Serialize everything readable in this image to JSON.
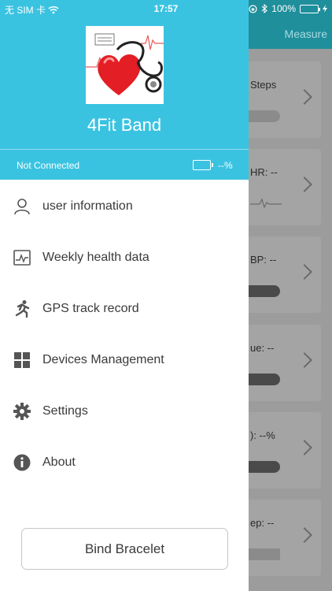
{
  "status_bar": {
    "carrier": "无 SIM 卡",
    "time": "17:57",
    "battery_percent": "100%"
  },
  "background_screen": {
    "header_action": "Measure",
    "cards": [
      {
        "label": "Steps"
      },
      {
        "label": "HR: --"
      },
      {
        "label": "BP: --"
      },
      {
        "label": "ue: --"
      },
      {
        "label": "): --%"
      },
      {
        "label": "ep: --"
      }
    ]
  },
  "drawer": {
    "app_name": "4Fit Band",
    "connection_status": "Not Connected",
    "device_battery": "--%",
    "menu": [
      {
        "label": "user information",
        "icon": "user-icon"
      },
      {
        "label": "Weekly health data",
        "icon": "health-chart-icon"
      },
      {
        "label": "GPS track record",
        "icon": "running-icon"
      },
      {
        "label": "Devices Management",
        "icon": "grid-icon"
      },
      {
        "label": "Settings",
        "icon": "gear-icon"
      },
      {
        "label": "About",
        "icon": "info-icon"
      }
    ],
    "bind_button": "Bind Bracelet"
  },
  "colors": {
    "drawer_header": "#3ac3e1",
    "dim_background": "#9a9a9a"
  }
}
